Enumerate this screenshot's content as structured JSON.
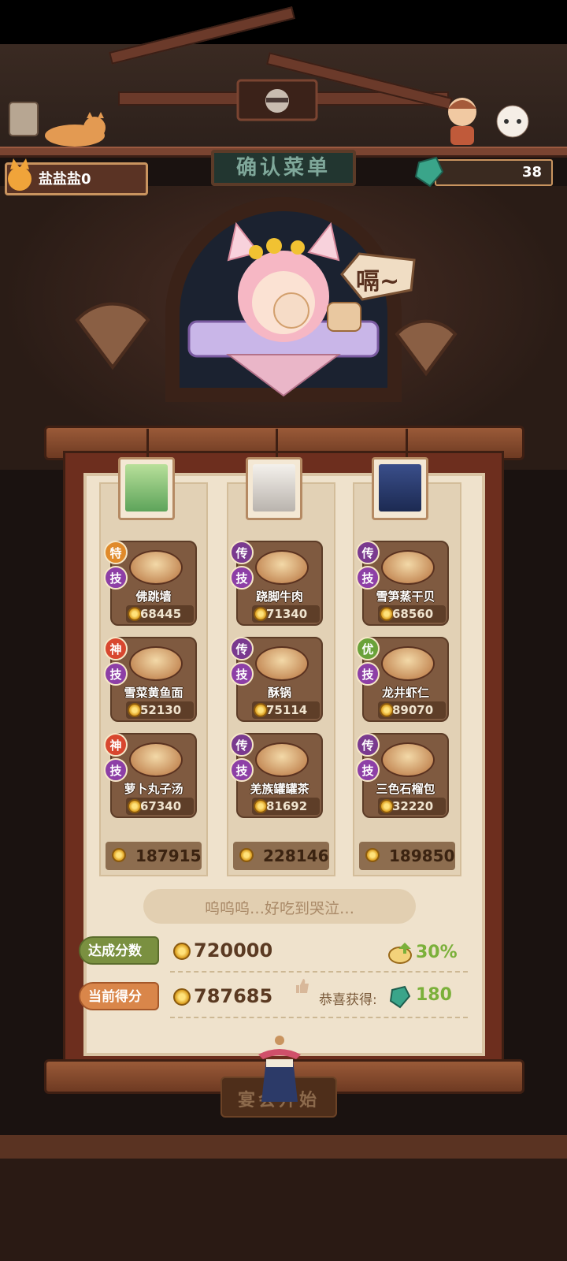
{
  "header": {
    "player_name": "盐盐盐0",
    "gem_count": "38",
    "sign_title": "确认菜单"
  },
  "host": {
    "speech_text": "嗝~"
  },
  "columns": [
    {
      "total": "187915",
      "dishes": [
        {
          "grade": "特",
          "grade_color": "#e08a2a",
          "skill": "技",
          "name": "佛跳墙",
          "score": "68445"
        },
        {
          "grade": "神",
          "grade_color": "#d8472f",
          "skill": "技",
          "name": "雪菜黄鱼面",
          "score": "52130"
        },
        {
          "grade": "神",
          "grade_color": "#d8472f",
          "skill": "技",
          "name": "萝卜丸子汤",
          "score": "67340"
        }
      ]
    },
    {
      "total": "228146",
      "dishes": [
        {
          "grade": "传",
          "grade_color": "#7a3a8f",
          "skill": "技",
          "name": "跷脚牛肉",
          "score": "71340"
        },
        {
          "grade": "传",
          "grade_color": "#7a3a8f",
          "skill": "技",
          "name": "酥锅",
          "score": "75114"
        },
        {
          "grade": "传",
          "grade_color": "#7a3a8f",
          "skill": "技",
          "name": "羌族罐罐茶",
          "score": "81692"
        }
      ]
    },
    {
      "total": "189850",
      "dishes": [
        {
          "grade": "传",
          "grade_color": "#7a3a8f",
          "skill": "技",
          "name": "雪笋蒸干贝",
          "score": "68560"
        },
        {
          "grade": "优",
          "grade_color": "#6aa23a",
          "skill": "技",
          "name": "龙井虾仁",
          "score": "89070"
        },
        {
          "grade": "传",
          "grade_color": "#7a3a8f",
          "skill": "技",
          "name": "三色石榴包",
          "score": "32220"
        }
      ]
    }
  ],
  "result": {
    "comment": "呜呜呜…好吃到哭泣…",
    "target_label": "达成分数",
    "target_score": "720000",
    "bonus_percent": "30%",
    "current_label": "当前得分",
    "current_score": "787685",
    "reward_label": "恭喜获得:",
    "reward_value": "180"
  },
  "start_button": {
    "label": "宴会开始"
  },
  "colors": {
    "panel_bg": "#efe2cc",
    "gem": "#3aa58a",
    "accent_green": "#7bb03a"
  }
}
